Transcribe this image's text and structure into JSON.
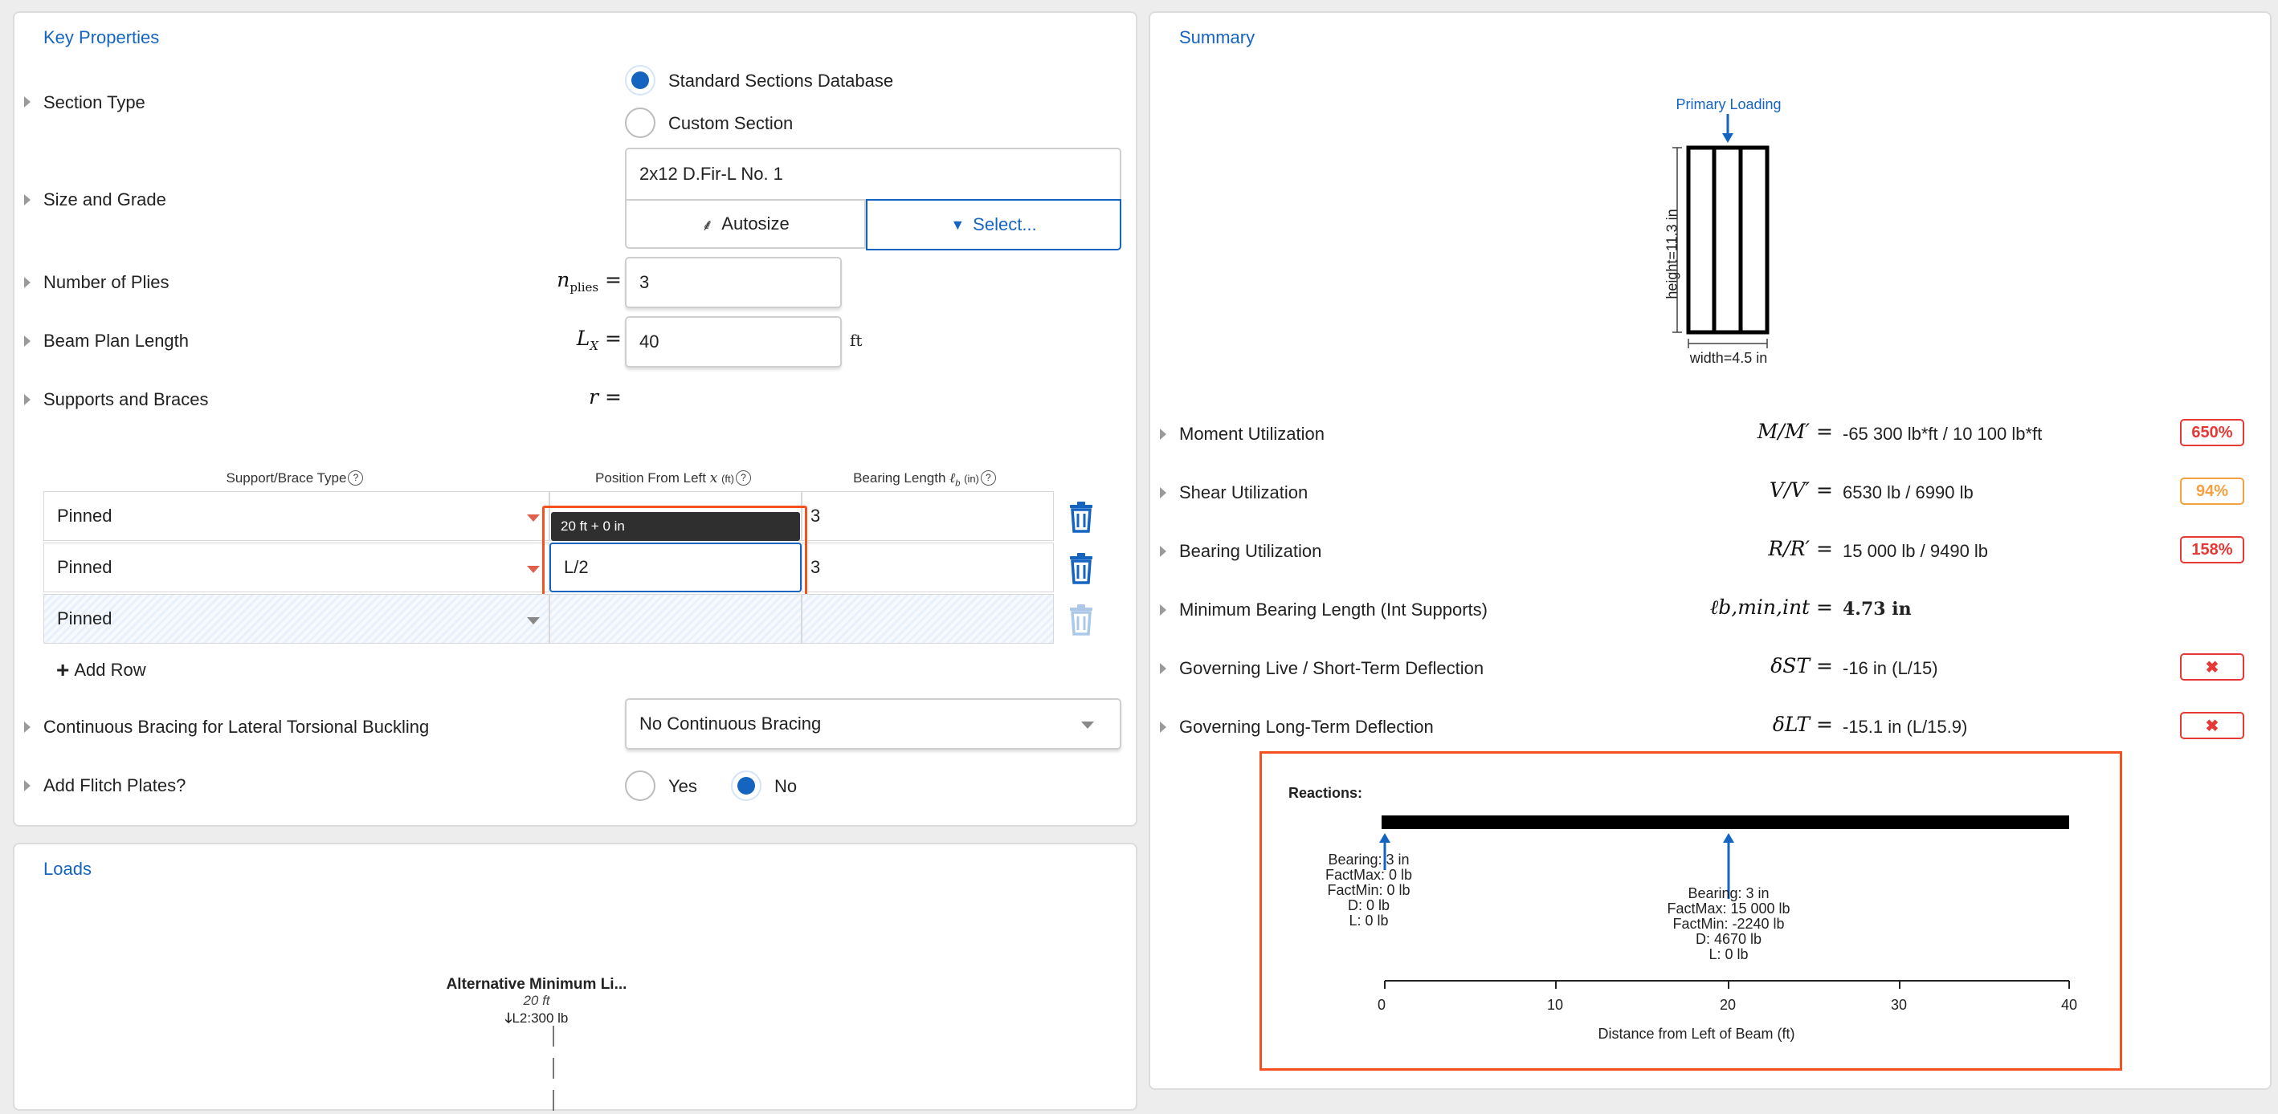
{
  "key_properties": {
    "title": "Key Properties",
    "section_type": {
      "label": "Section Type",
      "options": [
        "Standard Sections Database",
        "Custom Section"
      ],
      "selected": "Standard Sections Database"
    },
    "size_grade": {
      "label": "Size and Grade",
      "value": "2x12 D.Fir-L No. 1",
      "autosize_label": "Autosize",
      "select_label": "Select..."
    },
    "plies": {
      "label": "Number of Plies",
      "symbol": "n",
      "sub": "plies",
      "eq": "=",
      "value": "3"
    },
    "length": {
      "label": "Beam Plan Length",
      "symbol": "L",
      "sub": "X",
      "eq": "=",
      "value": "40",
      "unit": "ft"
    },
    "supports": {
      "label": "Supports and Braces",
      "symbol": "r",
      "eq": "="
    },
    "table": {
      "headers": [
        "Support/Brace Type",
        "Position From Left",
        "x",
        "(ft)",
        "Bearing Length",
        "ℓ",
        "b",
        "(in)"
      ],
      "help": "?",
      "rows": [
        {
          "type": "Pinned",
          "position": "",
          "bearing": "3"
        },
        {
          "type": "Pinned",
          "position": "L/2",
          "bearing": "3"
        },
        {
          "type": "Pinned",
          "position": "",
          "bearing": ""
        }
      ],
      "tooltip": "20 ft + 0 in",
      "add_row": "Add Row"
    },
    "bracing": {
      "label": "Continuous Bracing for Lateral Torsional Buckling",
      "value": "No Continuous Bracing"
    },
    "flitch": {
      "label": "Add Flitch Plates?",
      "options": [
        "Yes",
        "No"
      ],
      "selected": "No"
    }
  },
  "loads": {
    "title": "Loads",
    "load_name": "Alternative Minimum Li...",
    "load_pos": "20 ft",
    "load_value": "L2:300 lb"
  },
  "summary": {
    "title": "Summary",
    "section_diagram": {
      "primary_loading": "Primary Loading",
      "height": "height=11.3 in",
      "width": "width=4.5 in"
    },
    "rows": [
      {
        "label": "Moment Utilization",
        "symbol": "M/M′ =",
        "value": "-65 300 lb*ft / 10 100 lb*ft",
        "badge": "650%",
        "status": "red"
      },
      {
        "label": "Shear Utilization",
        "symbol": "V/V′ =",
        "value": "6530 lb / 6990 lb",
        "badge": "94%",
        "status": "orange"
      },
      {
        "label": "Bearing Utilization",
        "symbol": "R/R′ =",
        "value": "15 000 lb / 9490 lb",
        "badge": "158%",
        "status": "red"
      },
      {
        "label": "Minimum Bearing Length (Int Supports)",
        "symbol": "ℓb,min,int =",
        "value": "4.73 in",
        "badge": "",
        "status": "none"
      },
      {
        "label": "Governing Live / Short-Term Deflection",
        "symbol": "δST =",
        "value": "-16 in (L/15)",
        "badge": "✖",
        "status": "red"
      },
      {
        "label": "Governing Long-Term Deflection",
        "symbol": "δLT =",
        "value": "-15.1 in (L/15.9)",
        "badge": "✖",
        "status": "red"
      }
    ],
    "reactions": {
      "title": "Reactions:",
      "left": [
        "Bearing: 3 in",
        "FactMax: 0 lb",
        "FactMin: 0 lb",
        "D: 0 lb",
        "L: 0 lb"
      ],
      "mid": [
        "Bearing: 3 in",
        "FactMax: 15 000 lb",
        "FactMin: -2240 lb",
        "D: 4670 lb",
        "L: 0 lb"
      ],
      "ticks": [
        "0",
        "10",
        "20",
        "30",
        "40"
      ],
      "xlabel": "Distance from Left of Beam (ft)"
    }
  },
  "colors": {
    "accent": "#1565c0",
    "highlight": "#f4511e",
    "danger": "#e53935",
    "warning": "#f5a040"
  }
}
